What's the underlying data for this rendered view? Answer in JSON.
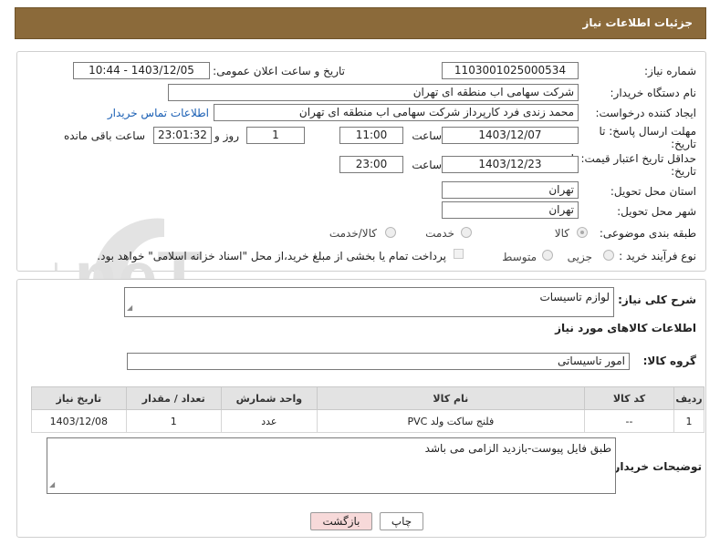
{
  "header": {
    "title": "جزئیات اطلاعات نیاز"
  },
  "form": {
    "need_number_label": "شماره نیاز:",
    "need_number": "1103001025000534",
    "announce_label": "تاریخ و ساعت اعلان عمومی:",
    "announce_value": "1403/12/05 - 10:44",
    "buyer_org_label": "نام دستگاه خریدار:",
    "buyer_org": "شرکت سهامی اب منطقه ای تهران",
    "creator_label": "ایجاد کننده درخواست:",
    "creator": "محمد زندی فرد کارپرداز شرکت سهامی اب منطقه ای تهران",
    "contact_link": "اطلاعات تماس خریدار",
    "deadline_label_1": "مهلت ارسال پاسخ: تا",
    "deadline_label_2": "تاریخ:",
    "deadline_date": "1403/12/07",
    "time_label": "ساعت",
    "deadline_time": "11:00",
    "days_value": "1",
    "days_label": "روز و",
    "remaining_time": "23:01:32",
    "remaining_label": "ساعت باقی مانده",
    "validity_label_1": "حداقل تاریخ اعتبار قیمت: تا",
    "validity_label_2": "تاریخ:",
    "validity_date": "1403/12/23",
    "validity_time_label": "ساعت",
    "validity_time": "23:00",
    "province_label": "استان محل تحویل:",
    "province": "تهران",
    "city_label": "شهر محل تحویل:",
    "city": "تهران",
    "category_label": "طبقه بندی موضوعی:",
    "category_options": [
      "کالا",
      "خدمت",
      "کالا/خدمت"
    ],
    "category_selected": "کالا",
    "process_label": "نوع فرآیند خرید :",
    "process_options": [
      "جزیی",
      "متوسط"
    ],
    "payment_note": "پرداخت تمام یا بخشی از مبلغ خرید،از محل \"اسناد خزانه اسلامی\" خواهد بود."
  },
  "details": {
    "summary_label": "شرح کلی نیاز:",
    "summary": "لوازم تاسیسات",
    "goods_info_title": "اطلاعات کالاهای مورد نیاز",
    "group_label": "گروه کالا:",
    "group": "امور تاسیساتی",
    "table": {
      "headers": [
        "ردیف",
        "کد کالا",
        "نام کالا",
        "واحد شمارش",
        "تعداد / مقدار",
        "تاریخ نیاز"
      ],
      "rows": [
        [
          "1",
          "--",
          "فلنج ساکت ولد PVC",
          "عدد",
          "1",
          "1403/12/08"
        ]
      ]
    },
    "buyer_notes_label": "توضیحات خریدار:",
    "buyer_notes": "طبق فایل پیوست-بازدید الزامی می باشد"
  },
  "buttons": {
    "print": "چاپ",
    "back": "بازگشت"
  },
  "watermark": {
    "text": "AriaTender.neT"
  },
  "colors": {
    "header_bg": "#8b6a3a",
    "back_button_bg": "#f7d9d9",
    "link": "#1a5fb4"
  }
}
